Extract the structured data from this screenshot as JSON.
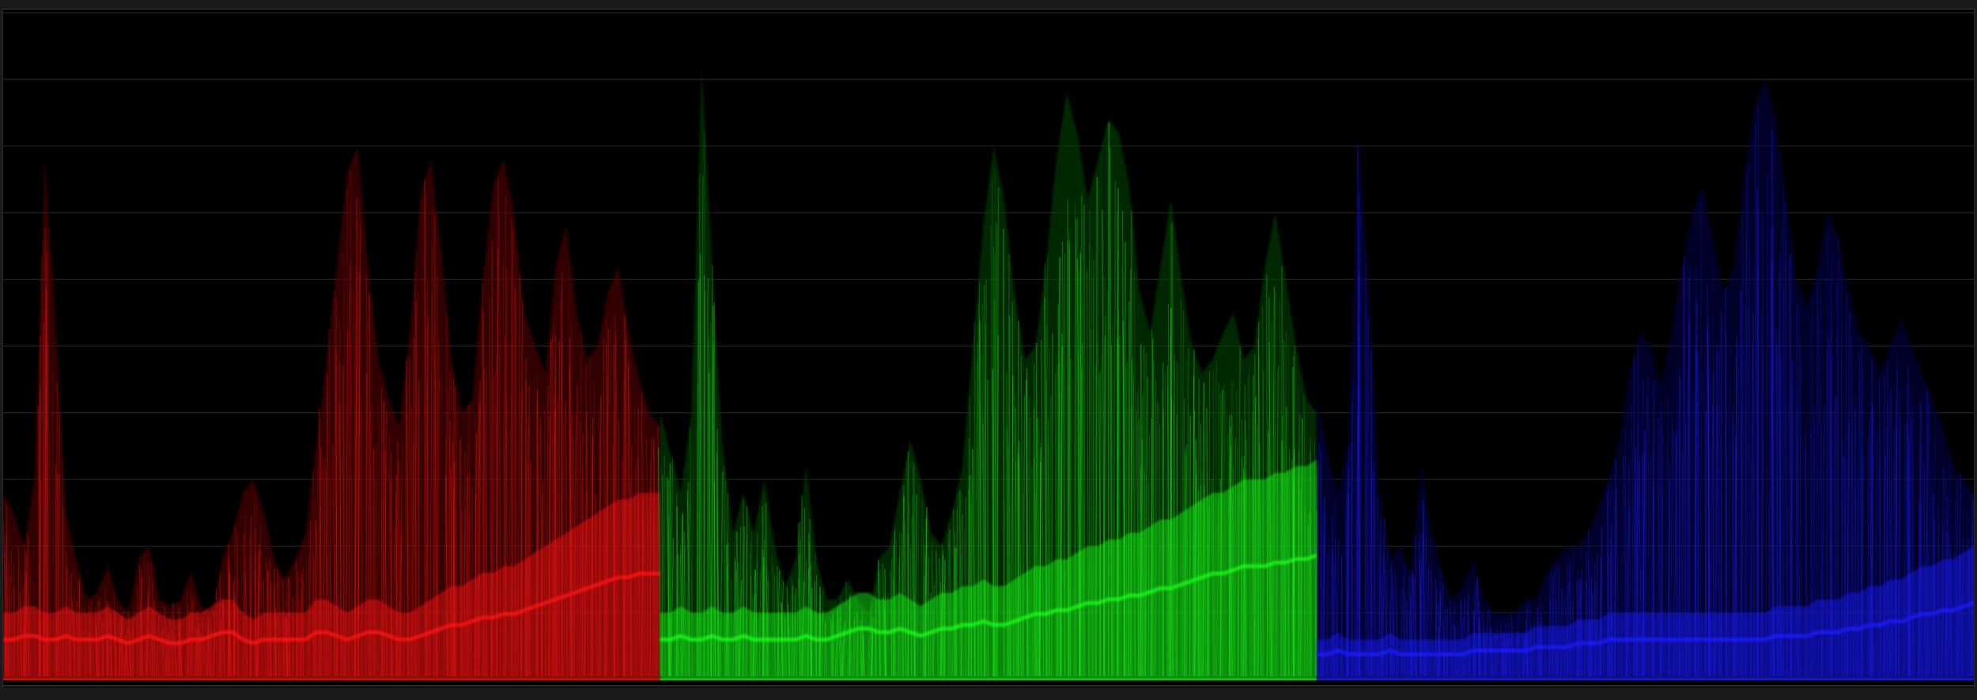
{
  "scope": {
    "type": "RGB parade waveform",
    "graticule_lines": 10,
    "channels": [
      {
        "name": "red",
        "color": "#ff1414",
        "dim_color": "#5a0000",
        "envelope": [
          0.28,
          0.25,
          0.2,
          0.3,
          0.78,
          0.55,
          0.25,
          0.18,
          0.12,
          0.13,
          0.17,
          0.12,
          0.1,
          0.18,
          0.2,
          0.12,
          0.11,
          0.12,
          0.16,
          0.11,
          0.1,
          0.18,
          0.22,
          0.28,
          0.3,
          0.25,
          0.18,
          0.15,
          0.18,
          0.22,
          0.35,
          0.48,
          0.62,
          0.76,
          0.8,
          0.62,
          0.48,
          0.42,
          0.38,
          0.52,
          0.72,
          0.78,
          0.65,
          0.48,
          0.4,
          0.42,
          0.6,
          0.74,
          0.78,
          0.7,
          0.55,
          0.5,
          0.46,
          0.62,
          0.68,
          0.55,
          0.48,
          0.5,
          0.58,
          0.62,
          0.52,
          0.45,
          0.4,
          0.38
        ],
        "floor": [
          0.1,
          0.1,
          0.11,
          0.11,
          0.1,
          0.1,
          0.11,
          0.1,
          0.1,
          0.1,
          0.11,
          0.1,
          0.09,
          0.1,
          0.11,
          0.1,
          0.09,
          0.09,
          0.1,
          0.1,
          0.11,
          0.12,
          0.12,
          0.1,
          0.09,
          0.1,
          0.1,
          0.1,
          0.1,
          0.1,
          0.12,
          0.12,
          0.11,
          0.1,
          0.11,
          0.12,
          0.12,
          0.11,
          0.1,
          0.1,
          0.11,
          0.12,
          0.13,
          0.14,
          0.14,
          0.15,
          0.16,
          0.16,
          0.17,
          0.17,
          0.18,
          0.19,
          0.2,
          0.21,
          0.22,
          0.23,
          0.24,
          0.25,
          0.26,
          0.27,
          0.27,
          0.28,
          0.28,
          0.28
        ]
      },
      {
        "name": "green",
        "color": "#1eff1e",
        "dim_color": "#004a00",
        "envelope": [
          0.4,
          0.34,
          0.28,
          0.4,
          0.92,
          0.62,
          0.35,
          0.22,
          0.28,
          0.22,
          0.3,
          0.2,
          0.14,
          0.18,
          0.32,
          0.18,
          0.12,
          0.12,
          0.15,
          0.12,
          0.1,
          0.18,
          0.2,
          0.28,
          0.36,
          0.3,
          0.22,
          0.2,
          0.25,
          0.32,
          0.5,
          0.68,
          0.8,
          0.72,
          0.58,
          0.48,
          0.5,
          0.62,
          0.78,
          0.88,
          0.82,
          0.72,
          0.78,
          0.84,
          0.82,
          0.74,
          0.58,
          0.52,
          0.62,
          0.72,
          0.6,
          0.5,
          0.46,
          0.48,
          0.52,
          0.55,
          0.48,
          0.5,
          0.62,
          0.7,
          0.6,
          0.5,
          0.42,
          0.4
        ],
        "floor": [
          0.1,
          0.1,
          0.11,
          0.1,
          0.1,
          0.11,
          0.1,
          0.1,
          0.11,
          0.1,
          0.1,
          0.1,
          0.1,
          0.1,
          0.11,
          0.1,
          0.1,
          0.11,
          0.12,
          0.13,
          0.13,
          0.12,
          0.12,
          0.13,
          0.12,
          0.11,
          0.12,
          0.13,
          0.13,
          0.14,
          0.14,
          0.15,
          0.14,
          0.14,
          0.15,
          0.16,
          0.17,
          0.17,
          0.18,
          0.18,
          0.19,
          0.2,
          0.2,
          0.21,
          0.21,
          0.22,
          0.22,
          0.23,
          0.24,
          0.24,
          0.25,
          0.26,
          0.27,
          0.28,
          0.28,
          0.29,
          0.3,
          0.3,
          0.3,
          0.31,
          0.31,
          0.32,
          0.32,
          0.33
        ]
      },
      {
        "name": "blue",
        "color": "#1e1eff",
        "dim_color": "#00004a",
        "envelope": [
          0.42,
          0.34,
          0.28,
          0.36,
          0.82,
          0.58,
          0.28,
          0.18,
          0.2,
          0.16,
          0.32,
          0.22,
          0.16,
          0.12,
          0.14,
          0.18,
          0.12,
          0.1,
          0.1,
          0.1,
          0.12,
          0.12,
          0.16,
          0.18,
          0.2,
          0.2,
          0.22,
          0.26,
          0.3,
          0.36,
          0.46,
          0.52,
          0.5,
          0.44,
          0.52,
          0.62,
          0.7,
          0.74,
          0.66,
          0.58,
          0.62,
          0.76,
          0.86,
          0.9,
          0.84,
          0.72,
          0.6,
          0.56,
          0.62,
          0.7,
          0.66,
          0.58,
          0.52,
          0.5,
          0.46,
          0.5,
          0.54,
          0.5,
          0.46,
          0.42,
          0.38,
          0.32,
          0.3,
          0.28
        ],
        "floor": [
          0.06,
          0.06,
          0.07,
          0.06,
          0.06,
          0.06,
          0.06,
          0.07,
          0.06,
          0.06,
          0.06,
          0.06,
          0.06,
          0.06,
          0.06,
          0.07,
          0.07,
          0.07,
          0.07,
          0.07,
          0.07,
          0.08,
          0.08,
          0.08,
          0.08,
          0.09,
          0.09,
          0.09,
          0.1,
          0.1,
          0.1,
          0.1,
          0.1,
          0.1,
          0.1,
          0.1,
          0.1,
          0.1,
          0.1,
          0.1,
          0.1,
          0.1,
          0.1,
          0.1,
          0.11,
          0.11,
          0.11,
          0.11,
          0.12,
          0.12,
          0.12,
          0.13,
          0.13,
          0.14,
          0.14,
          0.15,
          0.15,
          0.16,
          0.17,
          0.17,
          0.18,
          0.18,
          0.19,
          0.2
        ]
      }
    ]
  }
}
